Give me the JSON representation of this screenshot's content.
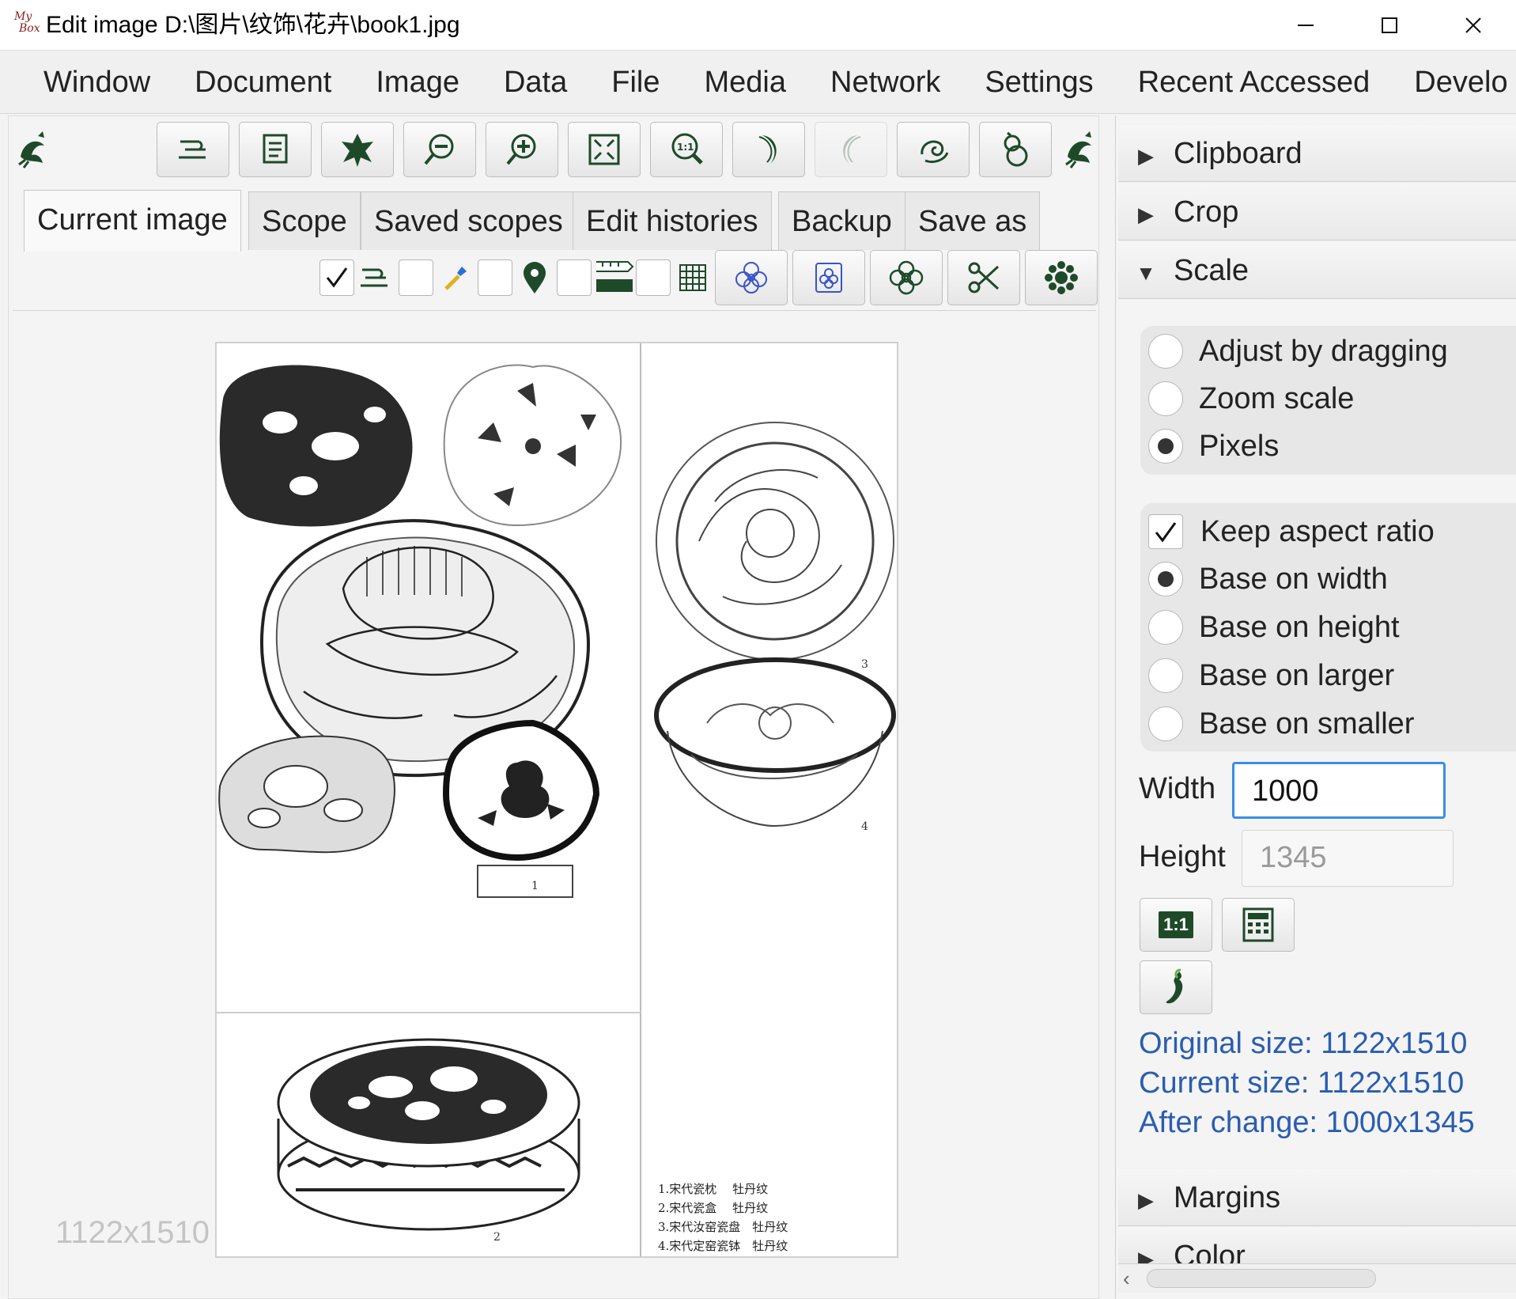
{
  "window": {
    "logo_text_1": "My",
    "logo_text_2": "Box",
    "title": "Edit image D:\\图片\\纹饰\\花卉\\book1.jpg"
  },
  "menu": [
    "Window",
    "Document",
    "Image",
    "Data",
    "File",
    "Media",
    "Network",
    "Settings",
    "Recent Accessed",
    "Develo"
  ],
  "toolbar": {
    "icons": [
      "bird-icon",
      "text-lines-icon",
      "notes-icon",
      "leaf-icon",
      "zoom-out-icon",
      "zoom-in-icon",
      "fit-window-icon",
      "zoom-actual-icon",
      "rotate-moon-icon",
      "rotate-moon-disabled-icon",
      "swirl-icon",
      "gourd-icon",
      "bird-icon"
    ]
  },
  "tabs": [
    "Current image",
    "Scope",
    "Saved scopes",
    "Edit histories",
    "Backup",
    "Save as"
  ],
  "image": {
    "size_label": "1122x1510",
    "caption_lines": [
      "1.宋代瓷枕　 牡丹纹",
      "2.宋代瓷盒　 牡丹纹",
      "3.宋代汝窑瓷盘　牡丹纹",
      "4.宋代定窑瓷钵　牡丹纹"
    ],
    "plate_numbers": [
      "1",
      "2",
      "3",
      "4"
    ]
  },
  "right_panel": {
    "sections": {
      "clipboard": "Clipboard",
      "crop": "Crop",
      "scale": "Scale",
      "margins": "Margins",
      "color": "Color"
    },
    "scale_mode": {
      "options": [
        "Adjust by dragging",
        "Zoom scale",
        "Pixels"
      ],
      "selected": "Pixels"
    },
    "keep_aspect_ratio": {
      "label": "Keep aspect ratio",
      "checked": true
    },
    "aspect_base": {
      "options": [
        "Base on width",
        "Base on height",
        "Base on larger",
        "Base on smaller"
      ],
      "selected": "Base on width"
    },
    "width": {
      "label": "Width",
      "value": "1000"
    },
    "height": {
      "label": "Height",
      "value": "1345"
    },
    "buttons": {
      "ratio_label": "1:1"
    },
    "info": {
      "original": "Original size: 1122x1510",
      "current": "Current size: 1122x1510",
      "after": "After change: 1000x1345"
    }
  },
  "colors": {
    "accent": "#1e4a2a",
    "info_text": "#2a5db0",
    "focus_border": "#3a8ee6"
  }
}
